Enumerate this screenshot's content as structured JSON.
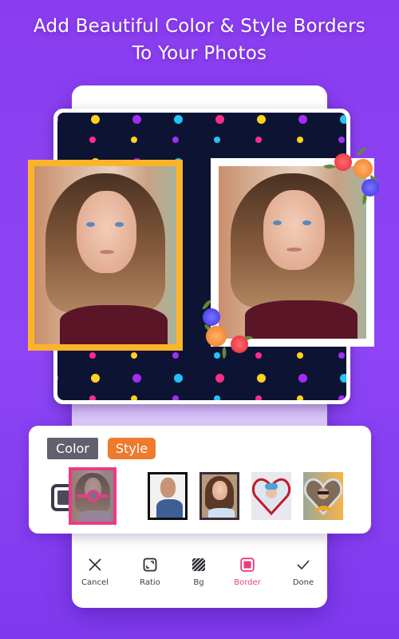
{
  "headline": {
    "line1": "Add Beautiful Color & Style Borders",
    "line2": "To Your Photos"
  },
  "colors": {
    "background": "#8a3df0",
    "canvas_bg": "#0d1433",
    "left_frame": "#fbb42a",
    "right_frame": "#ffffff",
    "accent_pink": "#ec3a86",
    "style_tab": "#ee7a2d",
    "color_tab": "#62606d",
    "dot_colors": [
      "#ff2d8a",
      "#21c4f7",
      "#a52cf5",
      "#ffd21f"
    ]
  },
  "canvas": {
    "photos": [
      {
        "name": "photo-left",
        "frame": "yellow-border"
      },
      {
        "name": "photo-right",
        "frame": "white-flower-border"
      }
    ]
  },
  "border_panel": {
    "tabs": [
      {
        "label": "Color",
        "active": false
      },
      {
        "label": "Style",
        "active": true
      }
    ],
    "none_option_icon": "no-border-icon",
    "styles": [
      {
        "name": "pink-ribbon-frame",
        "selected": true
      },
      {
        "name": "black-film-frame",
        "selected": false
      },
      {
        "name": "dark-photo-frame",
        "selected": false
      },
      {
        "name": "red-heart-frame",
        "selected": false
      },
      {
        "name": "silver-heart-frame",
        "selected": false
      }
    ]
  },
  "toolbar": {
    "items": [
      {
        "label": "Cancel",
        "icon": "close-icon",
        "active": false
      },
      {
        "label": "Ratio",
        "icon": "ratio-icon",
        "active": false
      },
      {
        "label": "Bg",
        "icon": "background-pattern-icon",
        "active": false
      },
      {
        "label": "Border",
        "icon": "border-icon",
        "active": true
      },
      {
        "label": "Done",
        "icon": "check-icon",
        "active": false
      }
    ]
  }
}
